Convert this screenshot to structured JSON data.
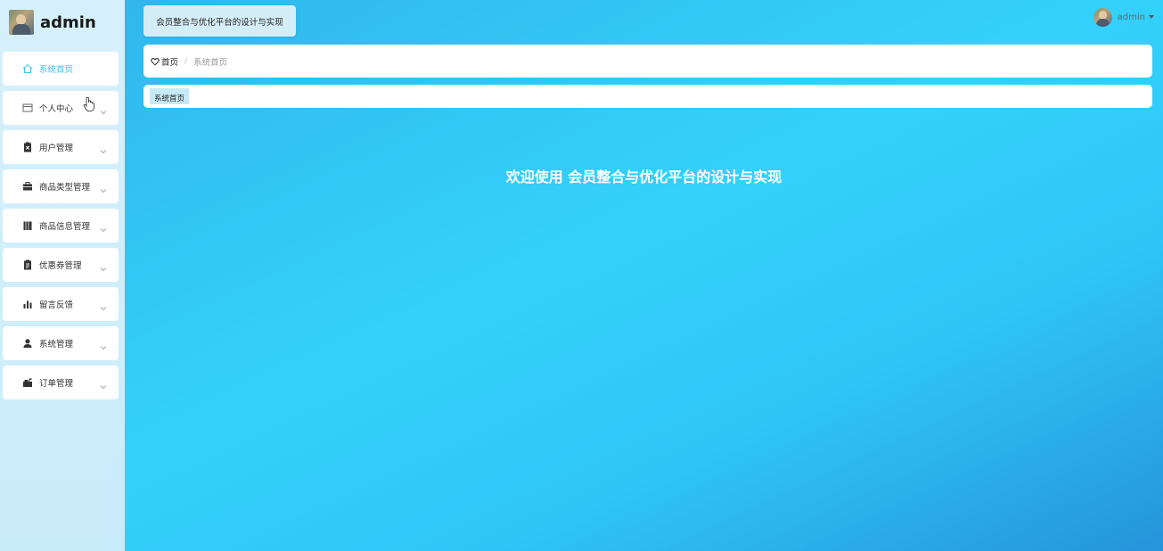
{
  "sidebar": {
    "brand_name": "admin",
    "items": [
      {
        "label": "系统首页",
        "icon": "home-icon",
        "has_chevron": false,
        "active": true
      },
      {
        "label": "个人中心",
        "icon": "card-icon",
        "has_chevron": true
      },
      {
        "label": "用户管理",
        "icon": "clipboard-x-icon",
        "has_chevron": true
      },
      {
        "label": "商品类型管理",
        "icon": "briefcase-icon",
        "has_chevron": true
      },
      {
        "label": "商品信息管理",
        "icon": "book-icon",
        "has_chevron": true
      },
      {
        "label": "优惠券管理",
        "icon": "clipboard-icon",
        "has_chevron": true
      },
      {
        "label": "留言反馈",
        "icon": "bar-chart-icon",
        "has_chevron": true
      },
      {
        "label": "系统管理",
        "icon": "user-icon",
        "has_chevron": true
      },
      {
        "label": "订单管理",
        "icon": "mailbox-icon",
        "has_chevron": true
      }
    ]
  },
  "header": {
    "title": "会员整合与优化平台的设计与实现",
    "user_name": "admin"
  },
  "breadcrumb": {
    "home": "首页",
    "separator": "/",
    "current": "系统首页"
  },
  "tags": {
    "active": "系统首页"
  },
  "welcome_text": "欢迎使用 会员整合与优化平台的设计与实现",
  "colors": {
    "accent": "#3cc2ea",
    "sidebar_bg": "#d6f0fb",
    "main_bg": "#33d2fc"
  }
}
